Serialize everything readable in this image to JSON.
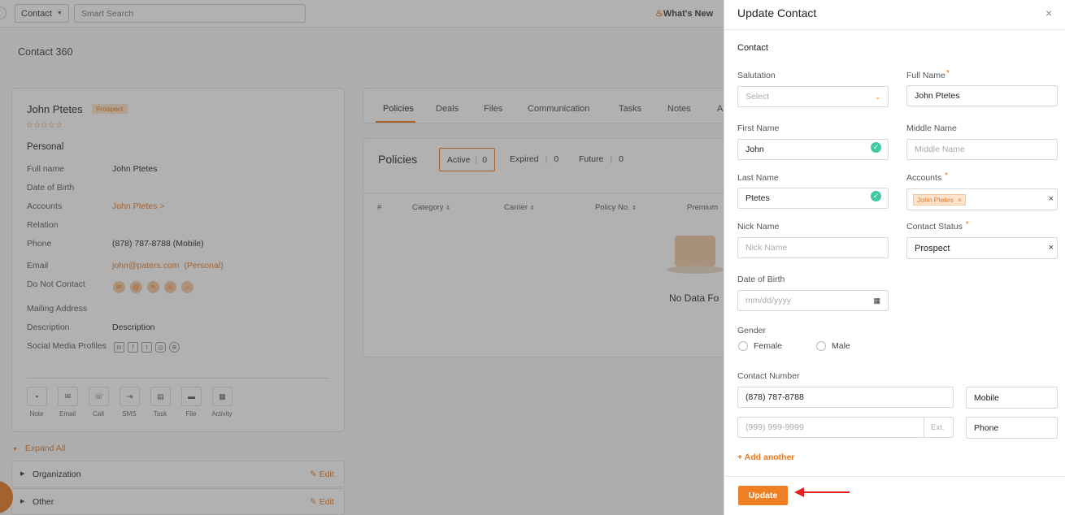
{
  "topbar": {
    "module_select": "Contact",
    "search_placeholder": "Smart Search",
    "whats_new": "What's New"
  },
  "page_title": "Contact 360",
  "profile": {
    "name": "John Ptetes",
    "badge": "Prospect",
    "stars": "☆☆☆☆☆",
    "section": "Personal",
    "fields": [
      {
        "label": "Full name",
        "value": "John Ptetes"
      },
      {
        "label": "Date of Birth",
        "value": ""
      },
      {
        "label": "Accounts",
        "value": "John Ptetes >"
      },
      {
        "label": "Relation",
        "value": ""
      },
      {
        "label": "Phone",
        "value": "(878) 787-8788 (Mobile)"
      },
      {
        "label": "Email",
        "value": "john@paters.com  (Personal)"
      },
      {
        "label": "Do Not Contact",
        "value": ""
      },
      {
        "label": "Mailing Address",
        "value": ""
      },
      {
        "label": "Description",
        "value": "Description"
      },
      {
        "label": "Social Media Profiles",
        "value": ""
      }
    ],
    "actions": [
      "Note",
      "Email",
      "Call",
      "SMS",
      "Task",
      "File",
      "Activity"
    ]
  },
  "expand_all": "Expand All",
  "accordions": [
    {
      "label": "Organization",
      "edit": "Edit"
    },
    {
      "label": "Other",
      "edit": "Edit"
    }
  ],
  "tabs": [
    "Policies",
    "Deals",
    "Files",
    "Communication",
    "Tasks",
    "Notes",
    "A"
  ],
  "policies": {
    "title": "Policies",
    "filters": [
      {
        "label": "Active",
        "count": "0"
      },
      {
        "label": "Expired",
        "count": "0"
      },
      {
        "label": "Future",
        "count": "0"
      }
    ],
    "columns": [
      "#",
      "Category",
      "Carrier",
      "Policy No.",
      "Premium"
    ],
    "empty": "No Data Fo"
  },
  "modal": {
    "title": "Update Contact",
    "section": "Contact",
    "salutation_label": "Salutation",
    "salutation_value": "Select",
    "full_name_label": "Full Name",
    "full_name_value": "John Ptetes",
    "first_name_label": "First Name",
    "first_name_value": "John",
    "middle_name_label": "Middle Name",
    "middle_name_placeholder": "Middle Name",
    "last_name_label": "Last Name",
    "last_name_value": "Ptetes",
    "accounts_label": "Accounts",
    "accounts_tag": "John Ptetes",
    "nick_name_label": "Nick Name",
    "nick_name_placeholder": "Nick Name",
    "contact_status_label": "Contact Status",
    "contact_status_value": "Prospect",
    "dob_label": "Date of Birth",
    "dob_placeholder": "mm/dd/yyyy",
    "gender_label": "Gender",
    "gender_female": "Female",
    "gender_male": "Male",
    "contact_number_label": "Contact Number",
    "phone1_value": "(878) 787-8788",
    "phone1_type": "Mobile",
    "phone2_placeholder": "(999) 999-9999",
    "ext_placeholder": "Ext.",
    "phone2_type": "Phone",
    "add_another": "+ Add another",
    "update_button": "Update",
    "required_mark": "*"
  },
  "colors": {
    "accent": "#e8781f",
    "check": "#40c9a2",
    "arrow": "#e02020"
  }
}
